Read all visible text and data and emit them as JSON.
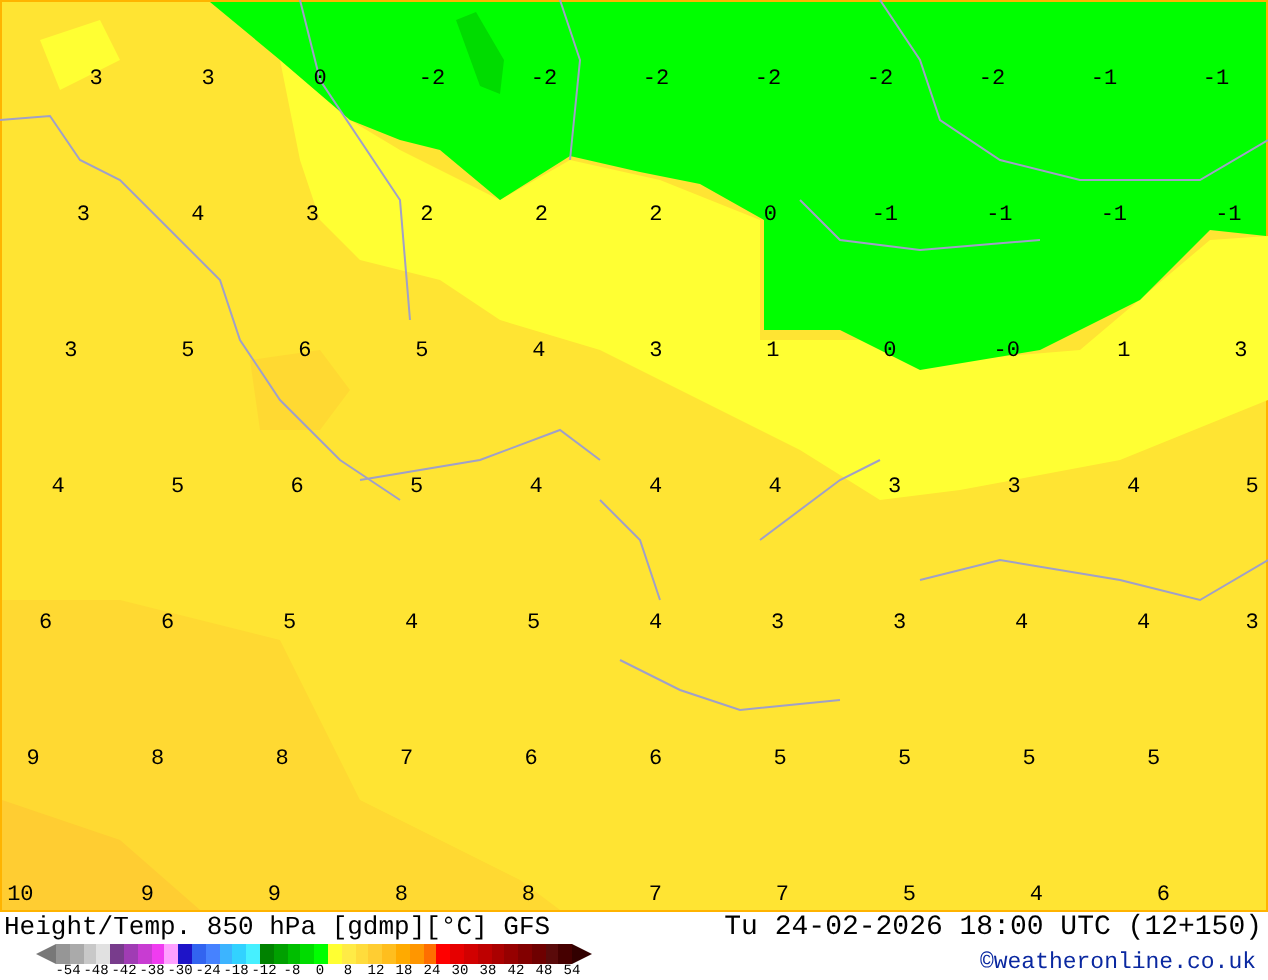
{
  "map": {
    "rows": [
      [
        "3",
        "3",
        "0",
        "-2",
        "-2",
        "-2",
        "-2",
        "-2",
        "-2",
        "-1",
        "-1"
      ],
      [
        "3",
        "4",
        "3",
        "2",
        "2",
        "2",
        "0",
        "-1",
        "-1",
        "-1",
        "-1"
      ],
      [
        "3",
        "5",
        "6",
        "5",
        "4",
        "3",
        "1",
        "0",
        "-0",
        "1",
        "3"
      ],
      [
        "4",
        "5",
        "6",
        "5",
        "4",
        "4",
        "4",
        "3",
        "3",
        "4",
        "5"
      ],
      [
        "6",
        "6",
        "5",
        "4",
        "5",
        "4",
        "3",
        "3",
        "4",
        "4",
        "3"
      ],
      [
        "9",
        "8",
        "8",
        "7",
        "6",
        "6",
        "5",
        "5",
        "5",
        "5"
      ],
      [
        "10",
        "9",
        "9",
        "8",
        "8",
        "7",
        "7",
        "5",
        "4",
        "6"
      ]
    ]
  },
  "footer": {
    "title": "Height/Temp. 850 hPa [gdmp][°C] GFS",
    "timestamp": "Tu 24-02-2026 18:00 UTC (12+150)",
    "copyright": "©weatheronline.co.uk",
    "swatches": [
      {
        "color": "#969696"
      },
      {
        "color": "#aaaaaa"
      },
      {
        "color": "#c8c8c8"
      },
      {
        "color": "#e1e1e1"
      },
      {
        "color": "#783c8c"
      },
      {
        "color": "#a03cb4"
      },
      {
        "color": "#c83cd2"
      },
      {
        "color": "#f03cf0"
      },
      {
        "color": "#ffa0ff"
      },
      {
        "color": "#1e14c8"
      },
      {
        "color": "#3264f0"
      },
      {
        "color": "#4682ff"
      },
      {
        "color": "#3cb4ff"
      },
      {
        "color": "#32d2ff"
      },
      {
        "color": "#46f0ff"
      },
      {
        "color": "#008200"
      },
      {
        "color": "#00a000"
      },
      {
        "color": "#00be00"
      },
      {
        "color": "#00dc00"
      },
      {
        "color": "#00ff00"
      },
      {
        "color": "#ffff32"
      },
      {
        "color": "#ffeb46"
      },
      {
        "color": "#ffdc3c"
      },
      {
        "color": "#ffcd32"
      },
      {
        "color": "#ffbe1e"
      },
      {
        "color": "#ffaa00"
      },
      {
        "color": "#ff9600"
      },
      {
        "color": "#ff6e00"
      },
      {
        "color": "#ff0000"
      },
      {
        "color": "#e60000"
      },
      {
        "color": "#d20000"
      },
      {
        "color": "#be0000"
      },
      {
        "color": "#aa0000"
      },
      {
        "color": "#960000"
      },
      {
        "color": "#820000"
      },
      {
        "color": "#6e0000"
      },
      {
        "color": "#5a0a0a"
      },
      {
        "color": "#460000"
      }
    ],
    "scale_labels": [
      "-54",
      "-48",
      "-42",
      "-38",
      "-30",
      "-24",
      "-18",
      "-12",
      "-8",
      "0",
      "8",
      "12",
      "18",
      "24",
      "30",
      "38",
      "42",
      "48",
      "54"
    ]
  }
}
